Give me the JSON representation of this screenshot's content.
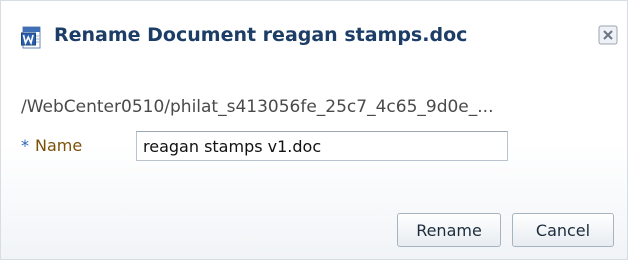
{
  "dialog": {
    "title": "Rename Document reagan stamps.doc",
    "icon": "word-document-icon",
    "close_icon": "close-icon"
  },
  "path": "/WebCenter0510/philat_s413056fe_25c7_4c65_9d0e_...",
  "form": {
    "required_mark": "*",
    "name_label": "Name",
    "name_value": "reagan stamps v1.doc"
  },
  "buttons": {
    "rename_label": "Rename",
    "cancel_label": "Cancel"
  },
  "colors": {
    "title": "#1b3d66",
    "label": "#7a5208",
    "required": "#2a62b8"
  }
}
